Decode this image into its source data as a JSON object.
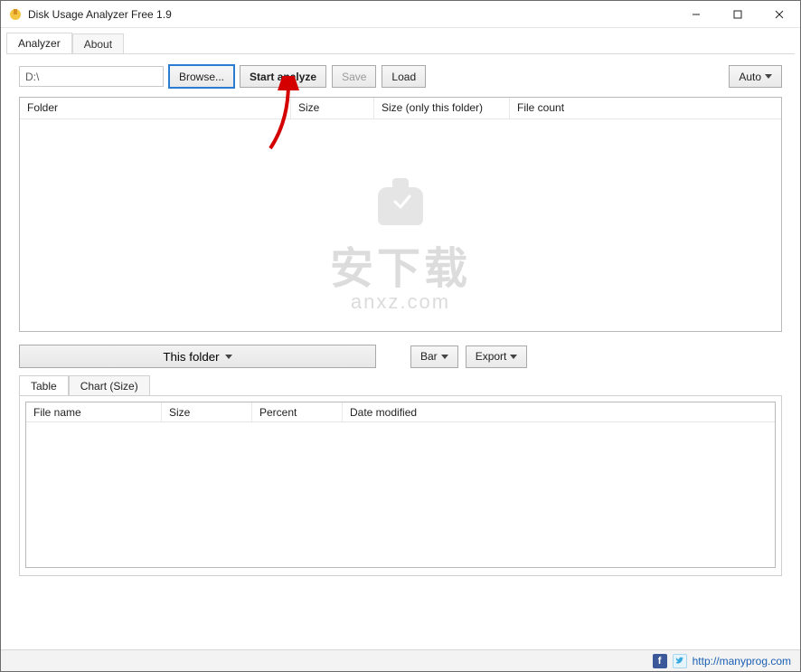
{
  "window": {
    "title": "Disk Usage Analyzer Free 1.9"
  },
  "tabs": {
    "main": [
      "Analyzer",
      "About"
    ]
  },
  "toolbar": {
    "path_value": "D:\\",
    "browse": "Browse...",
    "start": "Start analyze",
    "save": "Save",
    "load": "Load",
    "auto": "Auto"
  },
  "tree": {
    "columns": {
      "folder": "Folder",
      "size": "Size",
      "size_only": "Size (only this folder)",
      "file_count": "File count"
    }
  },
  "mid": {
    "this_folder": "This folder",
    "bar": "Bar",
    "export": "Export"
  },
  "lower": {
    "tabs": {
      "table": "Table",
      "chart": "Chart (Size)"
    },
    "columns": {
      "file_name": "File name",
      "size": "Size",
      "percent": "Percent",
      "date_modified": "Date modified"
    }
  },
  "status": {
    "url": "http://manyprog.com"
  },
  "watermark": {
    "zh": "安下载",
    "domain": "anxz.com"
  }
}
